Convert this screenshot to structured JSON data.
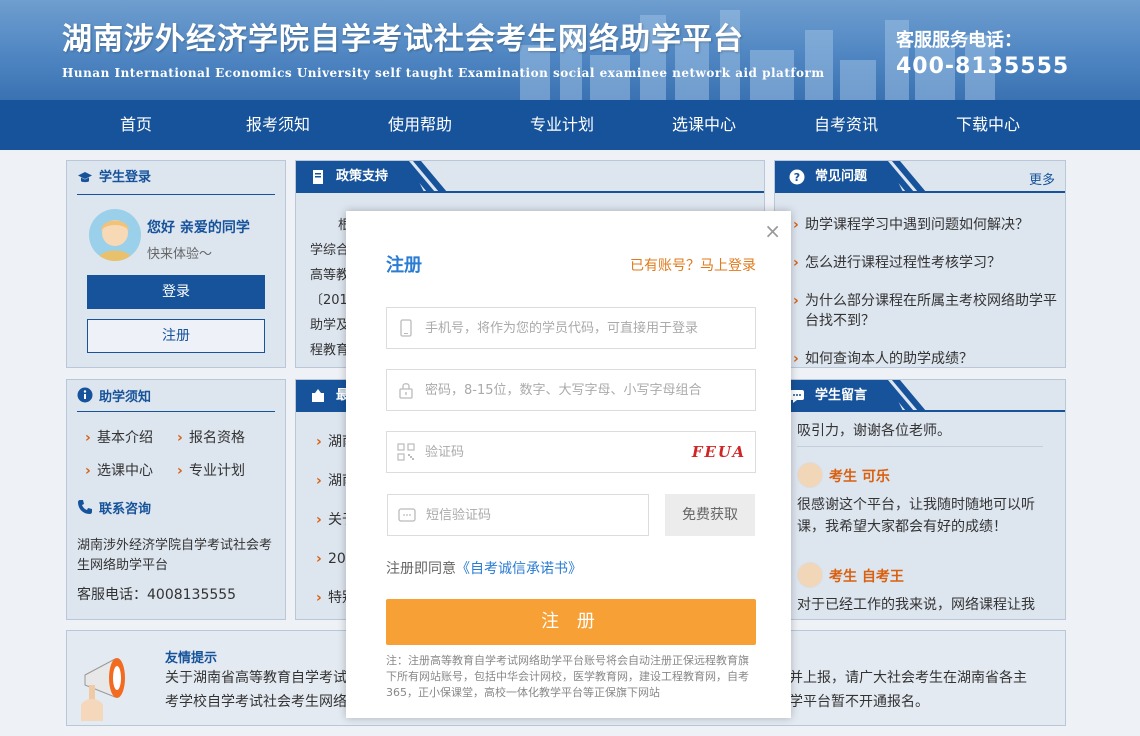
{
  "header": {
    "title": "湖南涉外经济学院自学考试社会考生网络助学平台",
    "subtitle": "Hunan International Economics University self taught Examination social examinee network aid platform",
    "hotline_label": "客服服务电话：",
    "hotline": "400-8135555"
  },
  "nav": {
    "items": [
      "首页",
      "报考须知",
      "使用帮助",
      "专业计划",
      "选课中心",
      "自考资讯",
      "下载中心"
    ]
  },
  "login": {
    "heading": "学生登录",
    "greeting": "您好 亲爱的同学",
    "greeting_sub": "快来体验～",
    "login_label": "登录",
    "register_label": "注册"
  },
  "policy": {
    "heading": "政策支持",
    "lines": [
      "根",
      "学综合",
      "高等教",
      "〔201",
      "助学及",
      "程教育"
    ]
  },
  "faq": {
    "heading": "常见问题",
    "more": "更多",
    "items": [
      "助学课程学习中遇到问题如何解决？",
      "怎么进行课程过程性考核学习？",
      "为什么部分课程在所属主考校网络助学平台找不到？",
      "如何查询本人的助学成绩？"
    ]
  },
  "guide": {
    "heading": "助学须知",
    "links": [
      "基本介绍",
      "报名资格",
      "选课中心",
      "专业计划"
    ],
    "contact_heading": "联系咨询",
    "contact_org": "湖南涉外经济学院自学考试社会考生网络助学平台",
    "contact_phone": "客服电话：4008135555"
  },
  "latest": {
    "heading": "最",
    "items": [
      "湖南",
      "湖南",
      "关于",
      "20",
      "特别"
    ]
  },
  "messages": {
    "heading": "学生留言",
    "entries": [
      {
        "name": "",
        "text": "吸引力，谢谢各位老师。"
      },
      {
        "name": "考生 可乐",
        "text": "很感谢这个平台，让我随时随地可以听课，我希望大家都会有好的成绩！"
      },
      {
        "name": "考生 自考王",
        "text": "对于已经工作的我来说，网络课程让我"
      }
    ]
  },
  "tip": {
    "heading": "友情提示",
    "left": "关于湖南省高等教育自学考试",
    "left2": "考学校自学考试社会考生网络",
    "right": "并上报，请广大社会考生在湖南省各主",
    "right2": "学平台暂不开通报名。"
  },
  "modal": {
    "title": "注册",
    "login_link": "已有账号？马上登录",
    "phone_placeholder": "手机号，将作为您的学员代码，可直接用于登录",
    "password_placeholder": "密码，8-15位，数字、大写字母、小写字母组合",
    "captcha_placeholder": "验证码",
    "captcha_text": "FEUA",
    "sms_placeholder": "短信验证码",
    "sms_button": "免费获取",
    "agree_prefix": "注册即同意",
    "agree_link": "《自考诚信承诺书》",
    "submit": "注 册",
    "note": "注：注册高等教育自学考试网络助学平台账号将会自动注册正保远程教育旗下所有网站账号，包括中华会计网校，医学教育网，建设工程教育网，自考365，正小保课堂，高校一体化教学平台等正保旗下网站",
    "close": "×"
  },
  "colors": {
    "primary": "#17539a",
    "accent": "#f7a035",
    "link": "#2b7cd3",
    "orange_text": "#e07a1c"
  }
}
